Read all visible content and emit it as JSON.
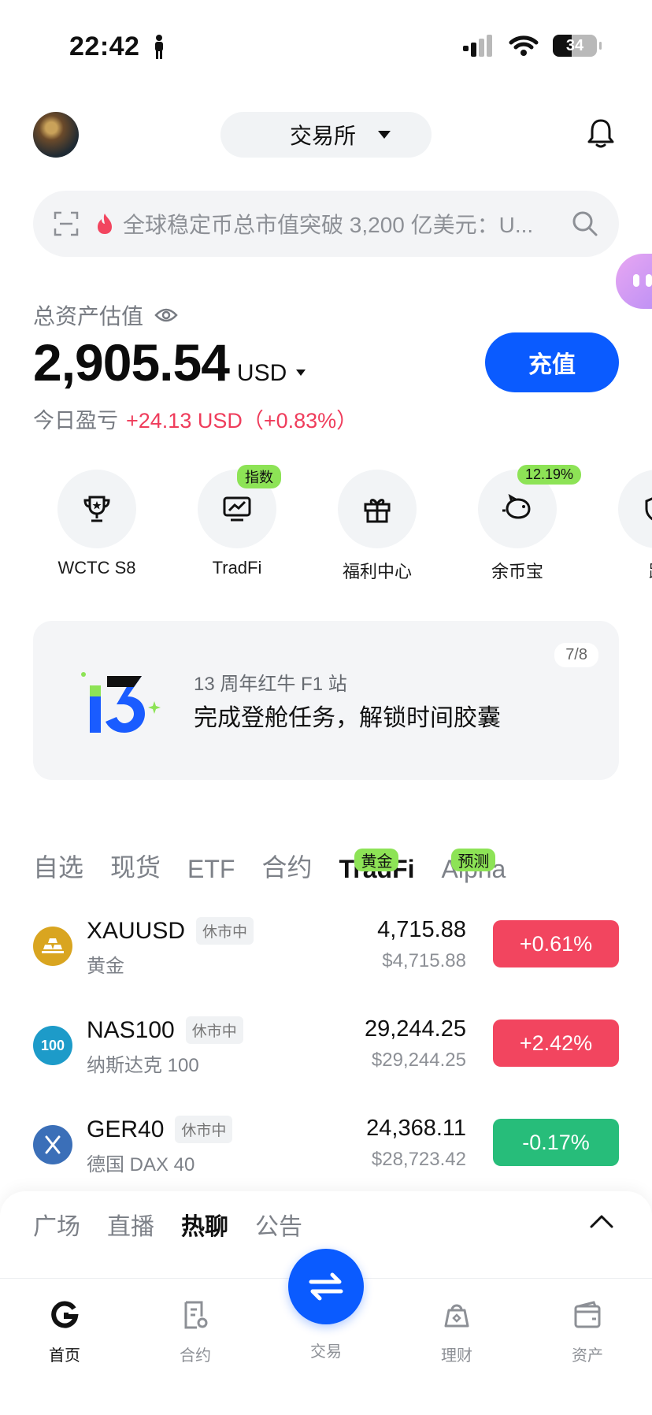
{
  "status_bar": {
    "time": "22:42",
    "battery": "34"
  },
  "header": {
    "exchange_label": "交易所"
  },
  "search": {
    "ticker_text": "全球稳定币总市值突破 3,200 亿美元：U..."
  },
  "assets": {
    "label": "总资产估值",
    "value": "2,905.54",
    "currency": "USD",
    "pnl_label": "今日盈亏",
    "pnl_value": "+24.13 USD（+0.83%）",
    "deposit_label": "充值"
  },
  "quick_actions": [
    {
      "label": "WCTC S8",
      "icon": "trophy-icon",
      "badge": ""
    },
    {
      "label": "TradFi",
      "icon": "chart-monitor-icon",
      "badge": "指数"
    },
    {
      "label": "福利中心",
      "icon": "gift-icon",
      "badge": ""
    },
    {
      "label": "余币宝",
      "icon": "piggy-bank-icon",
      "badge": "12.19%"
    },
    {
      "label": "跟",
      "icon": "shield-icon",
      "badge": ""
    }
  ],
  "banner": {
    "pager": "7/8",
    "subtitle": "13 周年红牛 F1 站",
    "title": "完成登舱任务，解锁时间胶囊"
  },
  "market_tabs": [
    {
      "label": "自选",
      "badge": ""
    },
    {
      "label": "现货",
      "badge": ""
    },
    {
      "label": "ETF",
      "badge": ""
    },
    {
      "label": "合约",
      "badge": ""
    },
    {
      "label": "TradFi",
      "badge": "黄金",
      "active": true
    },
    {
      "label": "Alpha",
      "badge": "预测"
    }
  ],
  "markets": [
    {
      "symbol": "XAUUSD",
      "tag": "休市中",
      "name": "黄金",
      "price": "4,715.88",
      "usd": "$4,715.88",
      "change": "+0.61%",
      "direction": "up",
      "icon_color": "#d9a520"
    },
    {
      "symbol": "NAS100",
      "tag": "休市中",
      "name": "纳斯达克 100",
      "price": "29,244.25",
      "usd": "$29,244.25",
      "change": "+2.42%",
      "direction": "up",
      "icon_color": "#1d9bc9",
      "icon_text": "100"
    },
    {
      "symbol": "GER40",
      "tag": "休市中",
      "name": "德国 DAX 40",
      "price": "24,368.11",
      "usd": "$28,723.42",
      "change": "-0.17%",
      "direction": "down",
      "icon_color": "#3b6fb8"
    }
  ],
  "feed_tabs": [
    {
      "label": "广场"
    },
    {
      "label": "直播"
    },
    {
      "label": "热聊",
      "active": true
    },
    {
      "label": "公告"
    }
  ],
  "bottom_nav": {
    "home": "首页",
    "futures": "合约",
    "trade": "交易",
    "earn": "理财",
    "assets": "资产"
  },
  "colors": {
    "accent": "#0a5bff",
    "up": "#f2455f",
    "down": "#27bd7a",
    "badge": "#8de356"
  }
}
